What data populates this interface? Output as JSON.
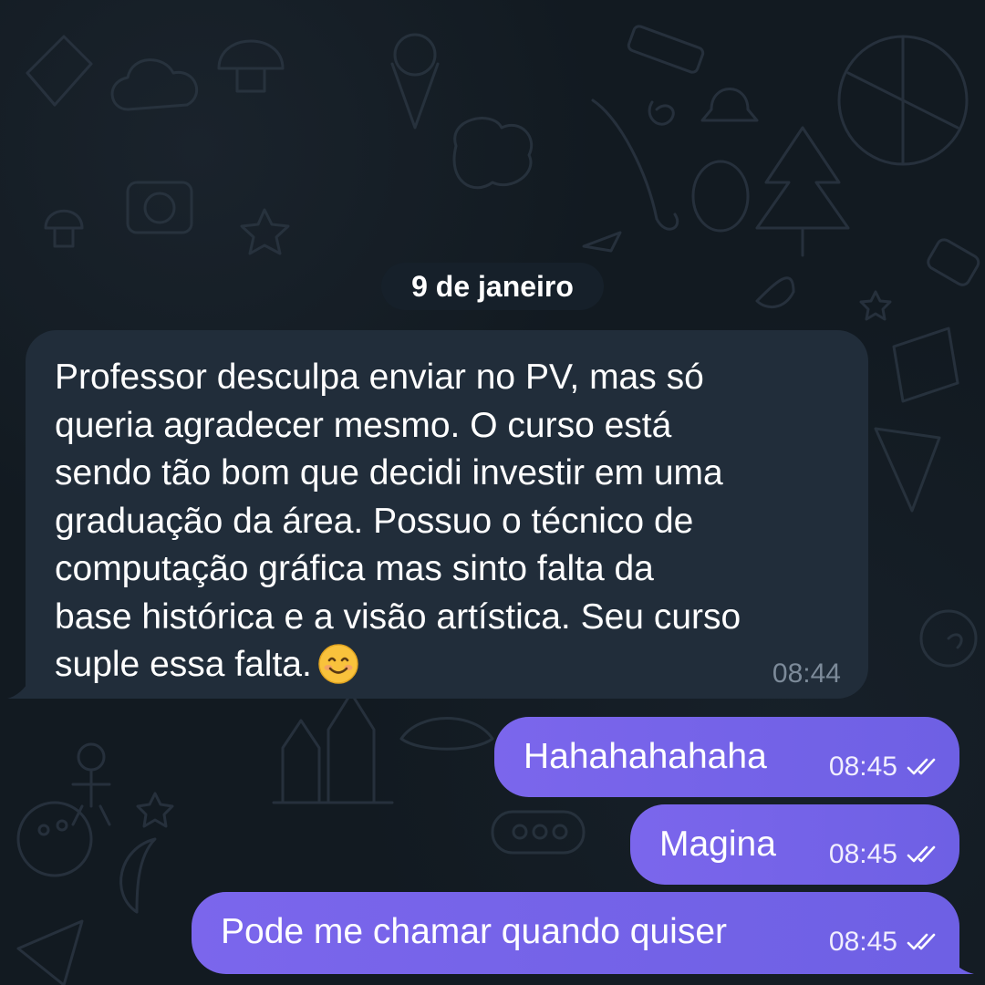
{
  "date_chip": "9 de janeiro",
  "incoming": {
    "text": "Professor desculpa enviar no PV, mas só\nqueria agradecer mesmo. O curso está\nsendo tão bom que decidi investir em uma\ngraduação da área. Possuo o técnico de\ncomputação gráfica mas sinto falta da\nbase histórica e a visão artística. Seu curso\nsuple essa falta.",
    "emoji": "smiling-face-icon",
    "time": "08:44"
  },
  "outgoing": [
    {
      "text": "Hahahahahaha",
      "time": "08:45",
      "status": "read"
    },
    {
      "text": "Magina",
      "time": "08:45",
      "status": "read"
    },
    {
      "text": "Pode me chamar quando quiser",
      "time": "08:45",
      "status": "read"
    }
  ],
  "colors": {
    "background": "#121a21",
    "incoming_bubble": "#212d3a",
    "outgoing_bubble": "#7563e8",
    "date_chip": "#16202a"
  }
}
